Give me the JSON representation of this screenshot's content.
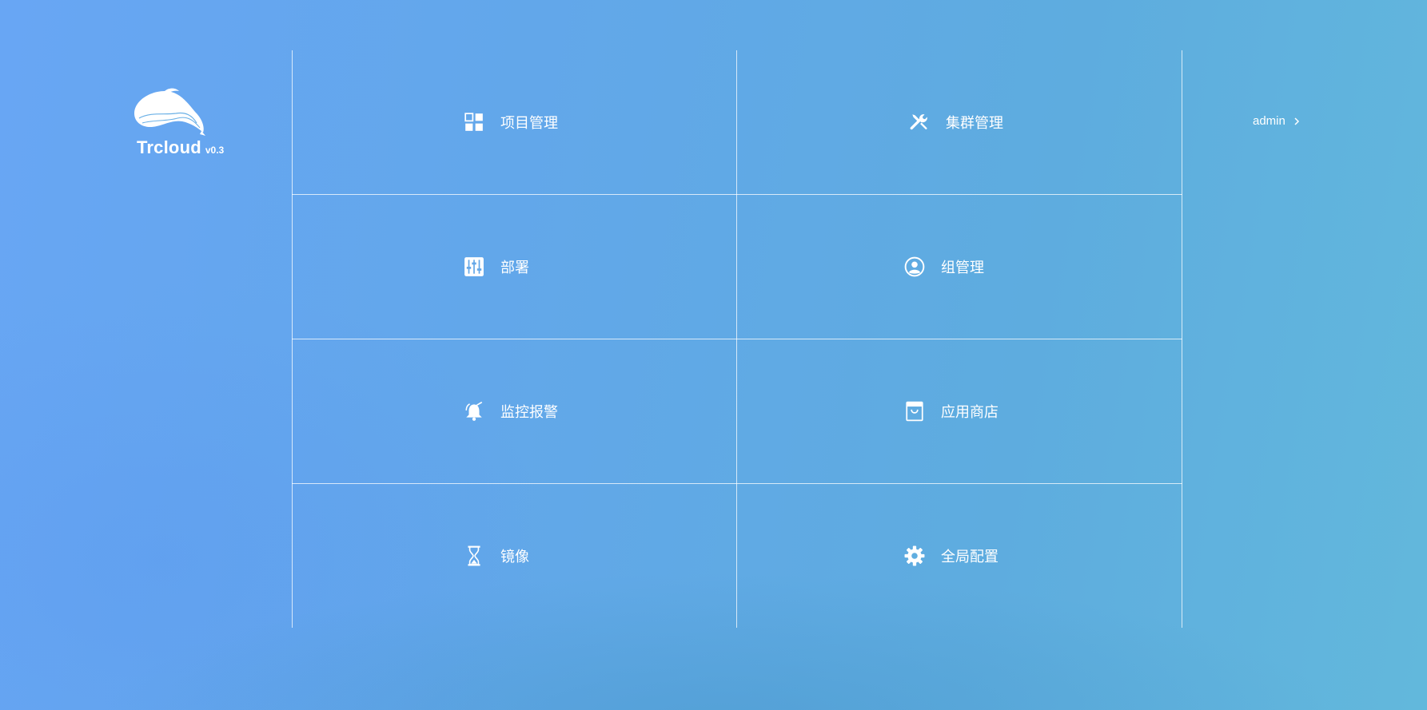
{
  "brand": {
    "name": "Trcloud",
    "version": "v0.3"
  },
  "user": {
    "name": "admin",
    "icon": "chevron-right-icon"
  },
  "menu": [
    {
      "label": "项目管理",
      "icon": "grid-icon"
    },
    {
      "label": "集群管理",
      "icon": "tools-icon"
    },
    {
      "label": "部署",
      "icon": "sliders-icon"
    },
    {
      "label": "组管理",
      "icon": "user-circle-icon"
    },
    {
      "label": "监控报警",
      "icon": "alarm-bell-icon"
    },
    {
      "label": "应用商店",
      "icon": "shopping-bag-icon"
    },
    {
      "label": "镜像",
      "icon": "hourglass-icon"
    },
    {
      "label": "全局配置",
      "icon": "gear-icon"
    }
  ]
}
